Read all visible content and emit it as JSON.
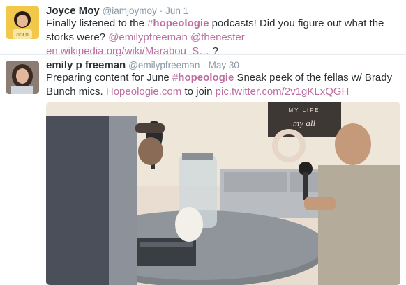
{
  "tweets": [
    {
      "name": "Joyce Moy",
      "handle": "@iamjoymoy",
      "sep": "·",
      "time": "Jun 1",
      "text_1": "Finally listened to the ",
      "hash_mark": "#",
      "hashtag": "hopeologie",
      "text_2": " podcasts! Did you figure out what the storks were? ",
      "mention_1": "@emilypfreeman",
      "mention_2": "@thenester",
      "url": "en.wikipedia.org/wiki/Marabou_S…",
      "text_3": " ?",
      "avatar_text": "GOLD"
    },
    {
      "name": "emily p freeman",
      "handle": "@emilypfreeman",
      "sep": "·",
      "time": "May 30",
      "text_1": "Preparing content for June ",
      "hash_mark": "#",
      "hashtag": "hopeologie",
      "text_2": " Sneak peek of the fellas w/ Brady Bunch mics. ",
      "link_1": "Hopeologie.com",
      "text_3": " to join ",
      "link_2": "pic.twitter.com/2v1gKLxQGH",
      "photo_sign_1": "MY LIFE",
      "photo_sign_2": "my all"
    }
  ],
  "colors": {
    "link": "#bc6fa0",
    "name": "#292f33",
    "meta": "#8899a6"
  }
}
